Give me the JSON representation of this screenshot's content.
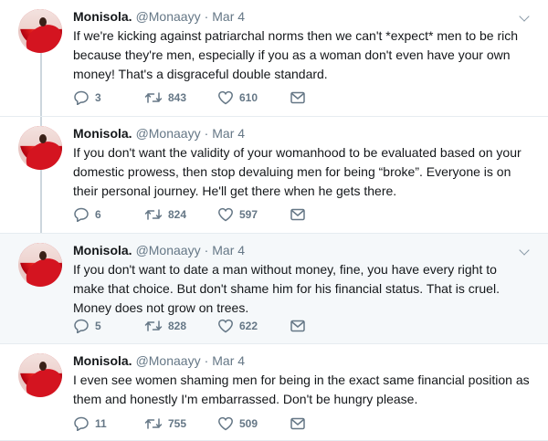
{
  "tweets": [
    {
      "name": "Monisola.",
      "handle": "@Monaayy",
      "date": "Mar 4",
      "text": "If we're kicking against patriarchal norms then we can't *expect* men to be rich because they're men, especially if you as a woman don't even have your own money! That's a disgraceful double standard.",
      "replies": "3",
      "retweets": "843",
      "likes": "610"
    },
    {
      "name": "Monisola.",
      "handle": "@Monaayy",
      "date": "Mar 4",
      "text": "If you don't want  the validity of your womanhood to be evaluated based on your domestic prowess, then stop devaluing men for being “broke”. Everyone is on their personal journey. He'll get there when he gets there.",
      "replies": "6",
      "retweets": "824",
      "likes": "597"
    },
    {
      "name": "Monisola.",
      "handle": "@Monaayy",
      "date": "Mar 4",
      "text": "If you don't want to date a man without money, fine, you have every right to make that choice. But don't shame him for his financial status. That is cruel. Money does not grow on trees.",
      "replies": "5",
      "retweets": "828",
      "likes": "622"
    },
    {
      "name": "Monisola.",
      "handle": "@Monaayy",
      "date": "Mar 4",
      "text": "I even see women shaming men for being in the exact same financial position as them and honestly I'm embarrassed. Don't be hungry please.",
      "replies": "11",
      "retweets": "755",
      "likes": "509"
    }
  ],
  "separator": "·",
  "colors": {
    "text": "#14171a",
    "secondary": "#657786",
    "border": "#e6ecf0",
    "highlight_bg": "#f5f8fa",
    "thread_line": "#ccd6dd"
  },
  "icons": [
    "reply-icon",
    "retweet-icon",
    "like-icon",
    "message-icon",
    "caret-down-icon"
  ]
}
